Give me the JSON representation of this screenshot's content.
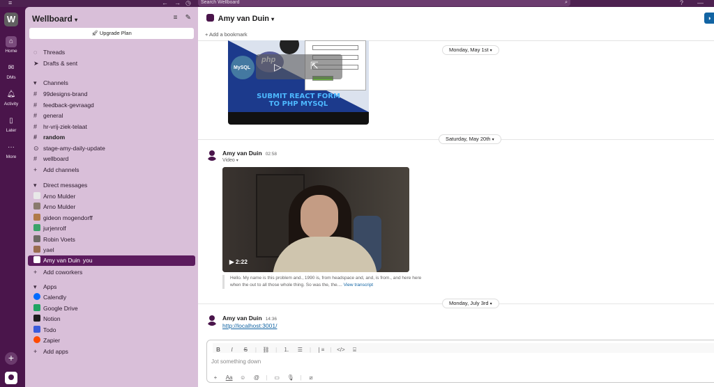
{
  "topbar": {
    "search_placeholder": "Search Wellboard",
    "back_icon": "arrow-left-icon",
    "forward_icon": "arrow-right-icon",
    "history_icon": "clock-icon",
    "help_icon": "help-icon"
  },
  "rail": {
    "workspace_initial": "W",
    "items": [
      {
        "label": "Home",
        "icon": "home-icon"
      },
      {
        "label": "DMs",
        "icon": "dms-icon"
      },
      {
        "label": "Activity",
        "icon": "bell-icon"
      },
      {
        "label": "Later",
        "icon": "bookmark-icon"
      },
      {
        "label": "More",
        "icon": "more-icon"
      }
    ]
  },
  "sidebar": {
    "workspace_name": "Wellboard",
    "upgrade_label": "Upgrade Plan",
    "top_items": [
      {
        "label": "Threads",
        "icon": "threads-icon"
      },
      {
        "label": "Drafts & sent",
        "icon": "send-icon"
      }
    ],
    "channels_header": "Channels",
    "channels": [
      {
        "name": "99designs-brand",
        "bold": false
      },
      {
        "name": "feedback-gevraagd",
        "bold": false
      },
      {
        "name": "general",
        "bold": false
      },
      {
        "name": "hr-vrij-ziek-telaat",
        "bold": false
      },
      {
        "name": "random",
        "bold": true
      },
      {
        "name": "stage-amy-daily-update",
        "bold": false
      },
      {
        "name": "wellboard",
        "bold": false
      }
    ],
    "add_channels": "Add channels",
    "dm_header": "Direct messages",
    "dms": [
      {
        "name": "Arno Mulder",
        "color": "#e8e8e8"
      },
      {
        "name": "Arno Mulder",
        "color": "#8a7a6e"
      },
      {
        "name": "gideon mogendorff",
        "color": "#b07a4a"
      },
      {
        "name": "jurjenrolf",
        "color": "#3aa36a"
      },
      {
        "name": "Robin Voets",
        "color": "#6e6a66"
      },
      {
        "name": "yael",
        "color": "#9a6c50"
      }
    ],
    "active_dm": {
      "name": "Amy van Duin",
      "suffix": "you"
    },
    "add_coworkers": "Add coworkers",
    "apps_header": "Apps",
    "apps": [
      {
        "name": "Calendly",
        "color": "#006bff"
      },
      {
        "name": "Google Drive",
        "color": "#1fa463"
      },
      {
        "name": "Notion",
        "color": "#1d1c1d"
      },
      {
        "name": "Todo",
        "color": "#3b5bdb"
      },
      {
        "name": "Zapier",
        "color": "#ff4a00"
      }
    ],
    "add_apps": "Add apps"
  },
  "channel": {
    "title": "Amy van Duin",
    "bookmark": "+ Add a bookmark"
  },
  "thumbnail": {
    "title_line1": "SUBMIT REACT FORM",
    "title_line2": "TO PHP MYSQL",
    "label_mysql": "MySQL",
    "label_php": "php"
  },
  "dates": {
    "d1": "Monday, May 1st",
    "d2": "Saturday, May 20th",
    "d3": "Monday, July 3rd"
  },
  "messages": [
    {
      "author": "Amy van Duin",
      "time": "02:58",
      "sub": "Video",
      "video_duration": "2:22",
      "transcript": "Hello. My name is this problem and., 1990 is, from headspace and, and, is from., and here here when the out to all those whole thing. So was the, the....",
      "transcript_link": "View transcript"
    },
    {
      "author": "Amy van Duin",
      "time": "14:36",
      "link": "http://localhost:3001/"
    }
  ],
  "composer": {
    "placeholder": "Jot something down",
    "format_label": "Aa"
  }
}
